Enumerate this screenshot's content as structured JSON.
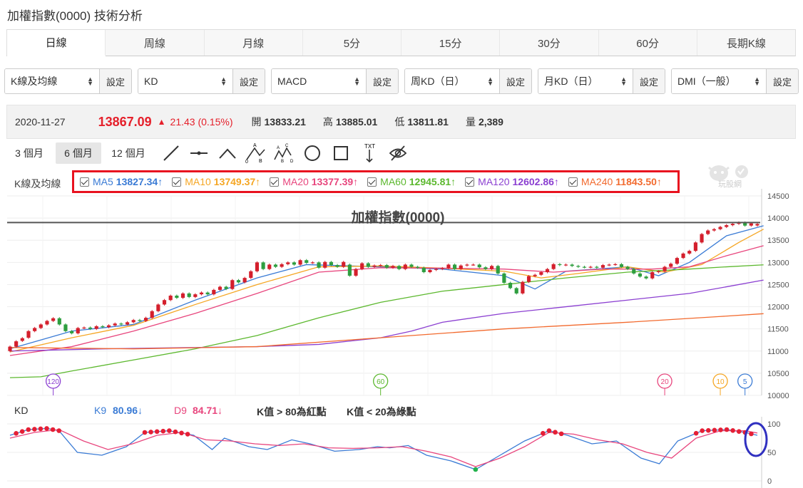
{
  "page": {
    "title": "加權指數(0000) 技術分析"
  },
  "tabs": [
    {
      "label": "日線",
      "active": true
    },
    {
      "label": "周線"
    },
    {
      "label": "月線"
    },
    {
      "label": "5分"
    },
    {
      "label": "15分"
    },
    {
      "label": "30分"
    },
    {
      "label": "60分"
    },
    {
      "label": "長期K線"
    }
  ],
  "selectors": [
    {
      "value": "K線及均線",
      "button": "設定"
    },
    {
      "value": "KD",
      "button": "設定"
    },
    {
      "value": "MACD",
      "button": "設定"
    },
    {
      "value": "周KD（日）",
      "button": "設定"
    },
    {
      "value": "月KD（日）",
      "button": "設定"
    },
    {
      "value": "DMI（一般）",
      "button": "設定"
    }
  ],
  "quote": {
    "date": "2020-11-27",
    "price": "13867.09",
    "change": "21.43 (0.15%)",
    "open_label": "開",
    "open": "13833.21",
    "high_label": "高",
    "high": "13885.01",
    "low_label": "低",
    "low": "13811.81",
    "volume_label": "量",
    "volume": "2,389"
  },
  "range_buttons": [
    "3 個月",
    "6 個月",
    "12 個月"
  ],
  "active_range": "6 個月",
  "tools": [
    "line-tool-icon",
    "horizontal-line-icon",
    "angle-icon",
    "abc-pattern-icon",
    "abcd-pattern-icon",
    "circle-icon",
    "rectangle-icon",
    "text-tool-icon",
    "hide-icon"
  ],
  "tool_text_label": "TXT",
  "ma_section_label": "K線及均線",
  "ma_legend": [
    {
      "name": "MA5",
      "value": "13827.34↑",
      "color": "#3a7bd5"
    },
    {
      "name": "MA10",
      "value": "13749.37↑",
      "color": "#f5a623"
    },
    {
      "name": "MA20",
      "value": "13377.39↑",
      "color": "#e8457d"
    },
    {
      "name": "MA60",
      "value": "12945.81↑",
      "color": "#5cb82e"
    },
    {
      "name": "MA120",
      "value": "12602.86↑",
      "color": "#8b3fd1"
    },
    {
      "name": "MA240",
      "value": "11843.50↑",
      "color": "#f26a2e"
    }
  ],
  "logo_text": "玩股網",
  "kd_legend": {
    "title": "KD",
    "k_name": "K9",
    "k_value": "80.96↓",
    "k_color": "#3a7bd5",
    "d_name": "D9",
    "d_value": "84.71↓",
    "d_color": "#e8457d",
    "note1": "K值 > 80為紅點",
    "note2": "K值 < 20為綠點"
  },
  "colors": {
    "up": "#d41f2c",
    "down": "#2e9e3f",
    "highlight_box": "#e8121f",
    "annotation_circle": "#3030c0"
  },
  "chart_data": [
    {
      "type": "candlestick",
      "title": "加權指數(0000)",
      "ylim": [
        10000,
        14500
      ],
      "yticks": [
        10000,
        10500,
        11000,
        11500,
        12000,
        12500,
        13000,
        13500,
        14000,
        14500
      ],
      "reference_line": 13900,
      "period_markers": [
        {
          "label": "120",
          "color": "#8b3fd1"
        },
        {
          "label": "60",
          "color": "#5cb82e"
        },
        {
          "label": "20",
          "color": "#e8457d"
        },
        {
          "label": "10",
          "color": "#f5a623"
        },
        {
          "label": "5",
          "color": "#3a7bd5"
        }
      ],
      "close": [
        11100,
        11220,
        11290,
        11450,
        11520,
        11600,
        11680,
        11740,
        11600,
        11450,
        11400,
        11520,
        11530,
        11500,
        11560,
        11540,
        11580,
        11620,
        11600,
        11650,
        11700,
        11680,
        11750,
        11900,
        12050,
        12150,
        12250,
        12200,
        12300,
        12220,
        12280,
        12320,
        12280,
        12380,
        12450,
        12400,
        12600,
        12550,
        12650,
        12800,
        13000,
        12850,
        12950,
        12900,
        12960,
        13000,
        12950,
        13050,
        12990,
        13000,
        12880,
        13010,
        12940,
        12900,
        13010,
        12700,
        12850,
        12980,
        12900,
        12930,
        12940,
        12880,
        12920,
        12850,
        12950,
        12900,
        12880,
        12780,
        12830,
        12850,
        12870,
        12950,
        12850,
        12930,
        12950,
        12950,
        12890,
        12850,
        12920,
        12750,
        12540,
        12420,
        12300,
        12560,
        12690,
        12720,
        12780,
        12850,
        12960,
        12940,
        12950,
        12920,
        12900,
        12890,
        12900,
        12880,
        12940,
        12950,
        12960,
        12900,
        12850,
        12750,
        12680,
        12640,
        12780,
        12800,
        12900,
        12970,
        13100,
        13200,
        13260,
        13450,
        13640,
        13720,
        13750,
        13800,
        13840,
        13870,
        13900,
        13830,
        13880,
        13867
      ],
      "open": [
        11000,
        11100,
        11230,
        11300,
        11450,
        11520,
        11600,
        11680,
        11740,
        11600,
        11450,
        11400,
        11520,
        11530,
        11500,
        11560,
        11540,
        11580,
        11620,
        11600,
        11650,
        11700,
        11680,
        11750,
        11900,
        12050,
        12150,
        12250,
        12200,
        12300,
        12220,
        12280,
        12320,
        12280,
        12380,
        12450,
        12400,
        12600,
        12550,
        12650,
        12800,
        13000,
        12850,
        12950,
        12900,
        12960,
        13000,
        12950,
        13050,
        12990,
        13000,
        12880,
        13010,
        12940,
        12900,
        12950,
        12700,
        12850,
        12980,
        12900,
        12930,
        12940,
        12880,
        12920,
        12850,
        12950,
        12900,
        12880,
        12780,
        12830,
        12850,
        12870,
        12950,
        12850,
        12930,
        12950,
        12950,
        12890,
        12850,
        12920,
        12750,
        12540,
        12420,
        12300,
        12560,
        12690,
        12720,
        12780,
        12850,
        12960,
        12940,
        12950,
        12920,
        12900,
        12890,
        12900,
        12880,
        12940,
        12950,
        12960,
        12900,
        12850,
        12750,
        12680,
        12640,
        12780,
        12800,
        12900,
        12970,
        13100,
        13200,
        13260,
        13450,
        13640,
        13720,
        13750,
        13800,
        13840,
        13870,
        13900,
        13830,
        13833
      ],
      "ma": [
        {
          "name": "MA5",
          "color": "#3a7bd5",
          "points": [
            [
              0,
              11050
            ],
            [
              10,
              11450
            ],
            [
              20,
              11600
            ],
            [
              30,
              12150
            ],
            [
              40,
              12650
            ],
            [
              48,
              12950
            ],
            [
              60,
              12900
            ],
            [
              70,
              12850
            ],
            [
              80,
              12700
            ],
            [
              85,
              12400
            ],
            [
              90,
              12800
            ],
            [
              100,
              12900
            ],
            [
              105,
              12700
            ],
            [
              110,
              13000
            ],
            [
              116,
              13600
            ],
            [
              122,
              13827
            ]
          ]
        },
        {
          "name": "MA10",
          "color": "#f5a623",
          "points": [
            [
              0,
              10980
            ],
            [
              10,
              11300
            ],
            [
              20,
              11580
            ],
            [
              30,
              12050
            ],
            [
              40,
              12500
            ],
            [
              50,
              12900
            ],
            [
              60,
              12920
            ],
            [
              70,
              12870
            ],
            [
              80,
              12800
            ],
            [
              86,
              12650
            ],
            [
              92,
              12750
            ],
            [
              100,
              12900
            ],
            [
              106,
              12780
            ],
            [
              112,
              12950
            ],
            [
              118,
              13450
            ],
            [
              122,
              13749
            ]
          ]
        },
        {
          "name": "MA20",
          "color": "#e8457d",
          "points": [
            [
              0,
              10900
            ],
            [
              10,
              11100
            ],
            [
              20,
              11450
            ],
            [
              30,
              11850
            ],
            [
              40,
              12300
            ],
            [
              50,
              12780
            ],
            [
              60,
              12880
            ],
            [
              70,
              12870
            ],
            [
              80,
              12850
            ],
            [
              88,
              12780
            ],
            [
              96,
              12850
            ],
            [
              104,
              12850
            ],
            [
              110,
              12900
            ],
            [
              116,
              13150
            ],
            [
              122,
              13377
            ]
          ]
        },
        {
          "name": "MA60",
          "color": "#5cb82e",
          "points": [
            [
              0,
              10400
            ],
            [
              5,
              10420
            ],
            [
              10,
              10550
            ],
            [
              20,
              10800
            ],
            [
              30,
              11050
            ],
            [
              40,
              11350
            ],
            [
              50,
              11750
            ],
            [
              60,
              12100
            ],
            [
              70,
              12350
            ],
            [
              80,
              12500
            ],
            [
              90,
              12650
            ],
            [
              100,
              12780
            ],
            [
              110,
              12850
            ],
            [
              116,
              12900
            ],
            [
              122,
              12945
            ]
          ]
        },
        {
          "name": "MA120",
          "color": "#8b3fd1",
          "points": [
            [
              0,
              11000
            ],
            [
              15,
              11050
            ],
            [
              30,
              11080
            ],
            [
              40,
              11100
            ],
            [
              50,
              11150
            ],
            [
              60,
              11300
            ],
            [
              65,
              11450
            ],
            [
              70,
              11650
            ],
            [
              80,
              11850
            ],
            [
              90,
              12000
            ],
            [
              100,
              12150
            ],
            [
              110,
              12300
            ],
            [
              116,
              12450
            ],
            [
              122,
              12602
            ]
          ]
        },
        {
          "name": "MA240",
          "color": "#f26a2e",
          "points": [
            [
              0,
              11080
            ],
            [
              20,
              11050
            ],
            [
              40,
              11100
            ],
            [
              60,
              11300
            ],
            [
              80,
              11500
            ],
            [
              100,
              11650
            ],
            [
              115,
              11780
            ],
            [
              122,
              11843
            ]
          ]
        }
      ]
    },
    {
      "type": "line",
      "title": "KD",
      "ylim": [
        0,
        100
      ],
      "yticks": [
        0,
        50,
        100
      ],
      "series": [
        {
          "name": "K9",
          "color": "#3a7bd5",
          "points": [
            [
              0,
              80
            ],
            [
              3,
              90
            ],
            [
              6,
              92
            ],
            [
              8,
              88
            ],
            [
              11,
              50
            ],
            [
              15,
              45
            ],
            [
              19,
              60
            ],
            [
              22,
              85
            ],
            [
              26,
              88
            ],
            [
              30,
              80
            ],
            [
              33,
              55
            ],
            [
              35,
              75
            ],
            [
              39,
              60
            ],
            [
              42,
              55
            ],
            [
              46,
              72
            ],
            [
              49,
              65
            ],
            [
              53,
              52
            ],
            [
              57,
              55
            ],
            [
              60,
              60
            ],
            [
              62,
              58
            ],
            [
              65,
              62
            ],
            [
              68,
              45
            ],
            [
              70,
              40
            ],
            [
              72,
              35
            ],
            [
              76,
              20
            ],
            [
              80,
              45
            ],
            [
              84,
              70
            ],
            [
              88,
              88
            ],
            [
              91,
              80
            ],
            [
              95,
              65
            ],
            [
              99,
              70
            ],
            [
              103,
              40
            ],
            [
              106,
              30
            ],
            [
              109,
              70
            ],
            [
              113,
              88
            ],
            [
              117,
              90
            ],
            [
              120,
              85
            ],
            [
              122,
              80
            ]
          ]
        },
        {
          "name": "D9",
          "color": "#e8457d",
          "points": [
            [
              0,
              75
            ],
            [
              4,
              85
            ],
            [
              8,
              90
            ],
            [
              12,
              70
            ],
            [
              16,
              55
            ],
            [
              20,
              65
            ],
            [
              24,
              80
            ],
            [
              28,
              85
            ],
            [
              32,
              72
            ],
            [
              36,
              70
            ],
            [
              40,
              65
            ],
            [
              44,
              62
            ],
            [
              48,
              65
            ],
            [
              52,
              58
            ],
            [
              56,
              57
            ],
            [
              60,
              58
            ],
            [
              64,
              60
            ],
            [
              68,
              52
            ],
            [
              72,
              42
            ],
            [
              76,
              25
            ],
            [
              80,
              40
            ],
            [
              84,
              60
            ],
            [
              88,
              85
            ],
            [
              92,
              82
            ],
            [
              96,
              72
            ],
            [
              100,
              65
            ],
            [
              104,
              50
            ],
            [
              108,
              40
            ],
            [
              112,
              75
            ],
            [
              116,
              88
            ],
            [
              120,
              88
            ],
            [
              122,
              84
            ]
          ]
        }
      ]
    }
  ]
}
